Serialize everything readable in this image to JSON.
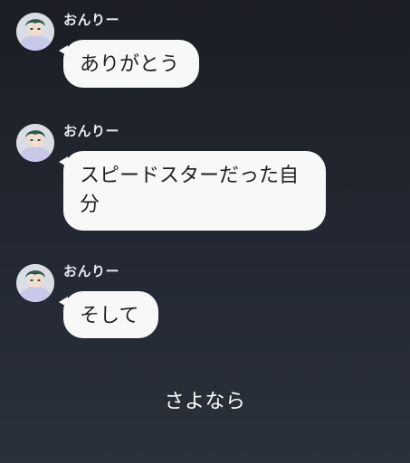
{
  "messages": [
    {
      "sender": "おんりー",
      "text": "ありがとう",
      "avatar_icon": "character-avatar-icon"
    },
    {
      "sender": "おんりー",
      "text_line1": "スピードスターだった自",
      "text_line2": "分",
      "avatar_icon": "character-avatar-icon"
    },
    {
      "sender": "おんりー",
      "text": "そして",
      "avatar_icon": "character-avatar-icon"
    }
  ],
  "caption": "さよなら",
  "colors": {
    "background_top": "#1b1e23",
    "background_bottom": "#2b313b",
    "bubble": "#f8f8f8",
    "bubble_text": "#1f1f1f",
    "name_text": "#e9edf4",
    "caption_text": "#ffffff"
  }
}
